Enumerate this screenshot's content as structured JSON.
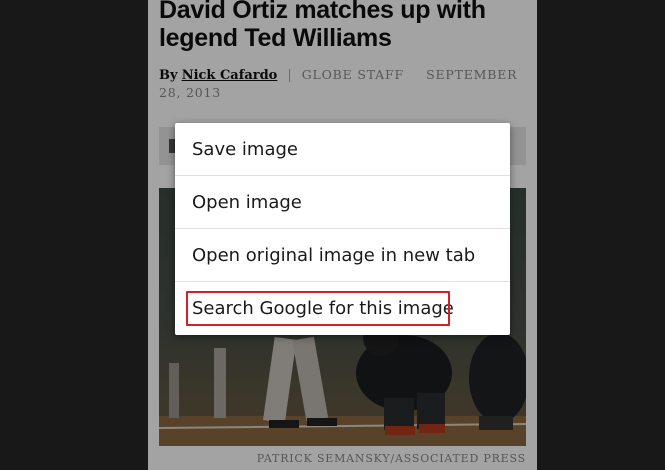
{
  "article": {
    "headline": "David Ortiz matches up with legend Ted Williams",
    "by_label": "By",
    "author": "Nick Cafardo",
    "separator": "|",
    "source": "GLOBE STAFF",
    "date": "SEPTEMBER 28, 2013",
    "photo_credit": "PATRICK SEMANSKY/ASSOCIATED PRESS"
  },
  "context_menu": {
    "items": [
      {
        "label": "Save image"
      },
      {
        "label": "Open image"
      },
      {
        "label": "Open original image in new tab"
      },
      {
        "label": "Search Google for this image"
      }
    ],
    "highlight_color": "#d0212a"
  },
  "colors": {
    "backdrop": "#262626",
    "page": "#ffffff"
  }
}
